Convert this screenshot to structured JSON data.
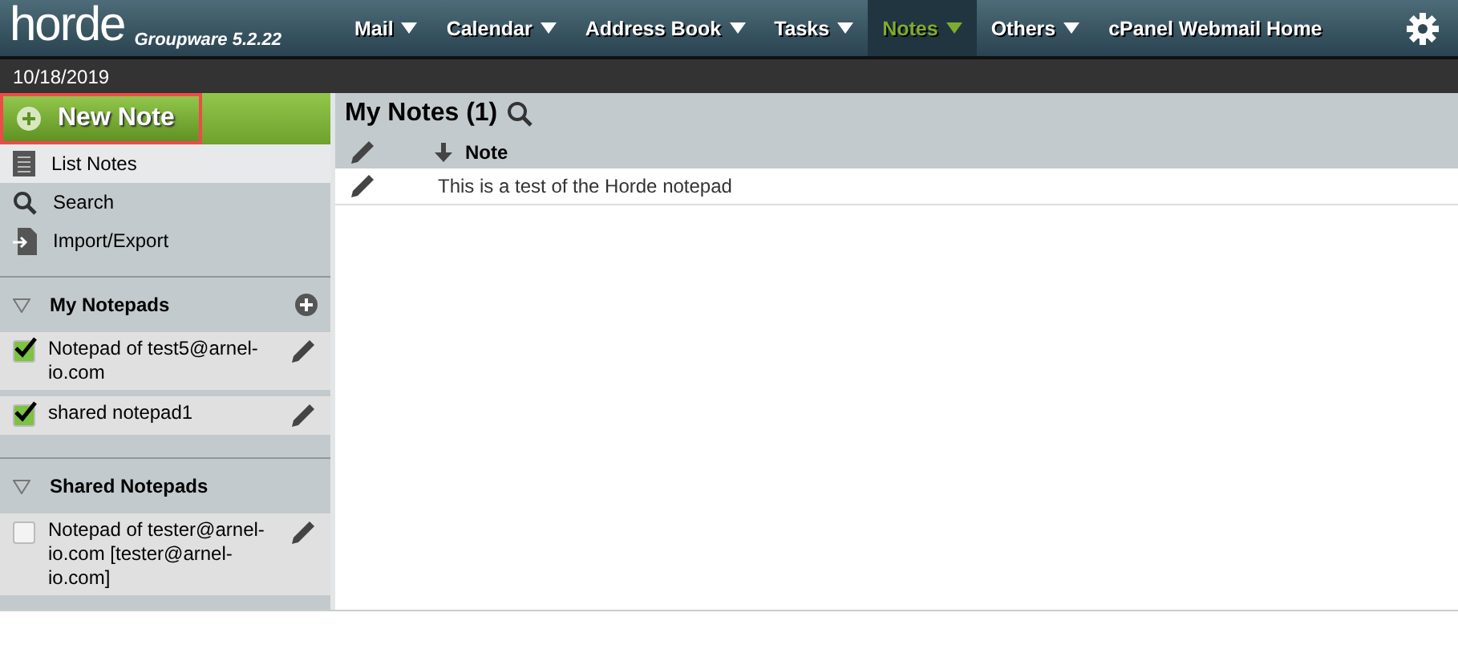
{
  "brand": {
    "logo": "horde",
    "product": "Groupware 5.2.22"
  },
  "menu": [
    {
      "label": "Mail",
      "kind": "dropdown",
      "selected": false
    },
    {
      "label": "Calendar",
      "kind": "dropdown",
      "selected": false
    },
    {
      "label": "Address Book",
      "kind": "dropdown",
      "selected": false
    },
    {
      "label": "Tasks",
      "kind": "dropdown",
      "selected": false
    },
    {
      "label": "Notes",
      "kind": "dropdown",
      "selected": true
    },
    {
      "label": "Others",
      "kind": "dropdown",
      "selected": false
    },
    {
      "label": "cPanel Webmail Home",
      "kind": "link",
      "selected": false
    }
  ],
  "date": "10/18/2019",
  "sidebar": {
    "new_note": "New Note",
    "items": [
      {
        "label": "List Notes",
        "kind": "list",
        "selected": true
      },
      {
        "label": "Search",
        "kind": "search",
        "selected": false
      },
      {
        "label": "Import/Export",
        "kind": "import",
        "selected": false
      }
    ],
    "sections": [
      {
        "title": "My Notepads",
        "expanded": true,
        "can_add": true,
        "notepads": [
          {
            "name": "Notepad of test5@arnel-io.com",
            "checked": true
          },
          {
            "name": "shared notepad1",
            "checked": true
          }
        ]
      },
      {
        "title": "Shared Notepads",
        "expanded": true,
        "can_add": false,
        "notepads": [
          {
            "name": "Notepad of tester@arnel-io.com [tester@arnel-io.com]",
            "checked": false
          }
        ]
      }
    ]
  },
  "main": {
    "title": "My Notes (1)",
    "columns": [
      {
        "label": "Note",
        "sort_descending": true
      }
    ],
    "rows": [
      {
        "note": "This is a test of the Horde notepad"
      }
    ]
  }
}
